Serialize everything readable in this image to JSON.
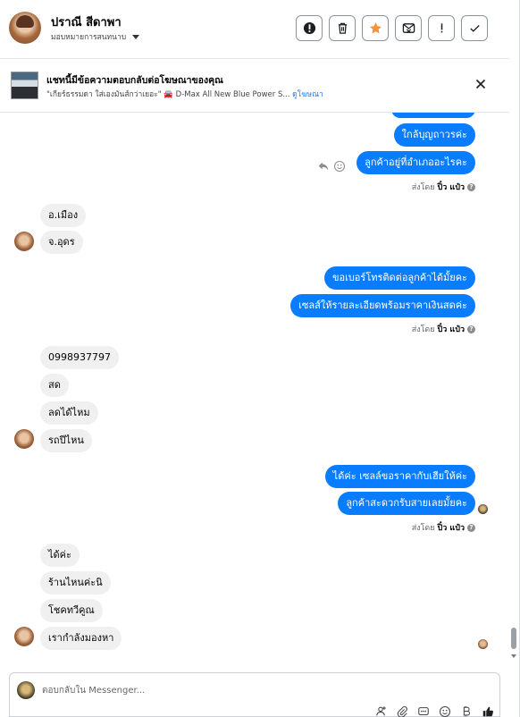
{
  "header": {
    "contact_name": "ปราณี สีดาพา",
    "assign_label": "มอบหมายการสนทนาบ",
    "buttons": [
      {
        "name": "spam-button",
        "icon": "alert-octagon-icon"
      },
      {
        "name": "delete-button",
        "icon": "trash-icon"
      },
      {
        "name": "star-button",
        "icon": "star-icon"
      },
      {
        "name": "mark-unread-button",
        "icon": "envelope-x-icon"
      },
      {
        "name": "follow-up-button",
        "icon": "exclamation-icon"
      },
      {
        "name": "done-button",
        "icon": "check-icon"
      }
    ],
    "star_color": "#f7923a"
  },
  "banner": {
    "title": "แชทนี้มีข้อความตอบกลับต่อโฆษณาของคุณ",
    "subtitle": "\"เกียร์ธรรมดา ใส่เองมันส์กว่าเยอะ\" 🚘 D-Max All New Blue Power S...",
    "link": "ดูโฆษณา"
  },
  "messages": {
    "out_1": "ใกล้บุญถาวรค่ะ",
    "out_2": "ลูกค้าอยู่ที่อำเภออะไรคะ",
    "sent_by_prefix": "ส่งโดย",
    "sent_by_name": "ปิ๋ว แป๋ว",
    "in_1": "อ.เมือง",
    "in_2": "จ.อุดร",
    "out_3": "ขอเบอร์โทรติดต่อลูกค้าได้มั้ยคะ",
    "out_4": "เซลส์ให้รายละเอียดพร้อมราคาเงินสดค่ะ",
    "in_3": "0998937797",
    "in_4": "สด",
    "in_5": "ลดได้ไหม",
    "in_6": "รถปีไหน",
    "out_5": "ได้ค่ะ เซลล์ขอราคากับเฮียให้ค่ะ",
    "out_6": "ลูกค้าสะดวกรับสายเลยมั้ยคะ",
    "in_7": "ได้ค่ะ",
    "in_8": "ร้านไหนค่ะนิ",
    "in_9": "โชคทวีคูณ",
    "in_10": "เรากำลังมองหา"
  },
  "composer": {
    "placeholder": "ตอบกลับใน Messenger..."
  },
  "colors": {
    "outgoing": "#0a7cff",
    "incoming": "#f0f0f0",
    "link": "#1877f2"
  }
}
